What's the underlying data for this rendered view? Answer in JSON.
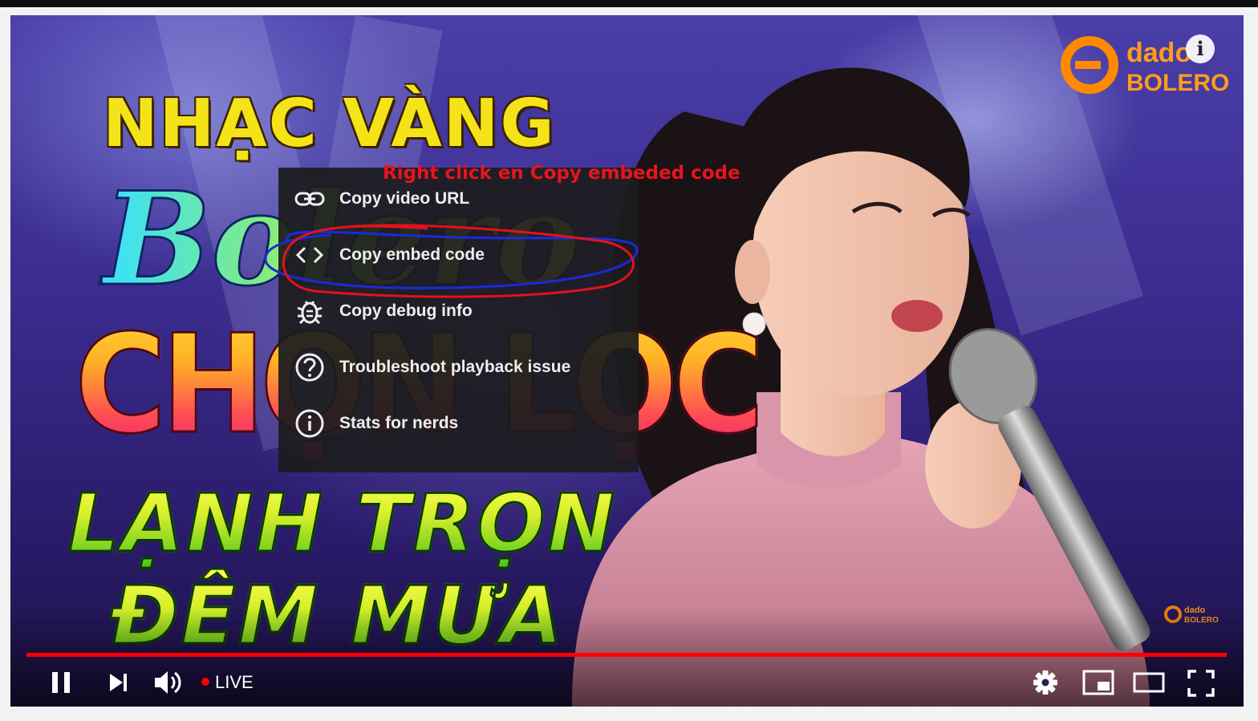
{
  "video": {
    "title_lines": [
      "NHẠC VÀNG",
      "Bolero",
      "CHỌN LỌC",
      "LẠNH TRỌN",
      "ĐÊM MƯA"
    ],
    "watermark_brand": "dado",
    "watermark_sub": "BOLERO",
    "info_label": "i"
  },
  "annotation": {
    "text": "Right click en Copy embeded code",
    "color": "#e8141c"
  },
  "context_menu": {
    "items": [
      {
        "label": "Copy video URL",
        "icon": "link-icon"
      },
      {
        "label": "Copy embed code",
        "icon": "code-brackets-icon"
      },
      {
        "label": "Copy debug info",
        "icon": "bug-icon"
      },
      {
        "label": "Troubleshoot playback issue",
        "icon": "question-circle-icon"
      },
      {
        "label": "Stats for nerds",
        "icon": "info-circle-icon"
      }
    ]
  },
  "controls": {
    "live_label": "LIVE",
    "progress": 1.0,
    "accent": "#ff0000"
  }
}
